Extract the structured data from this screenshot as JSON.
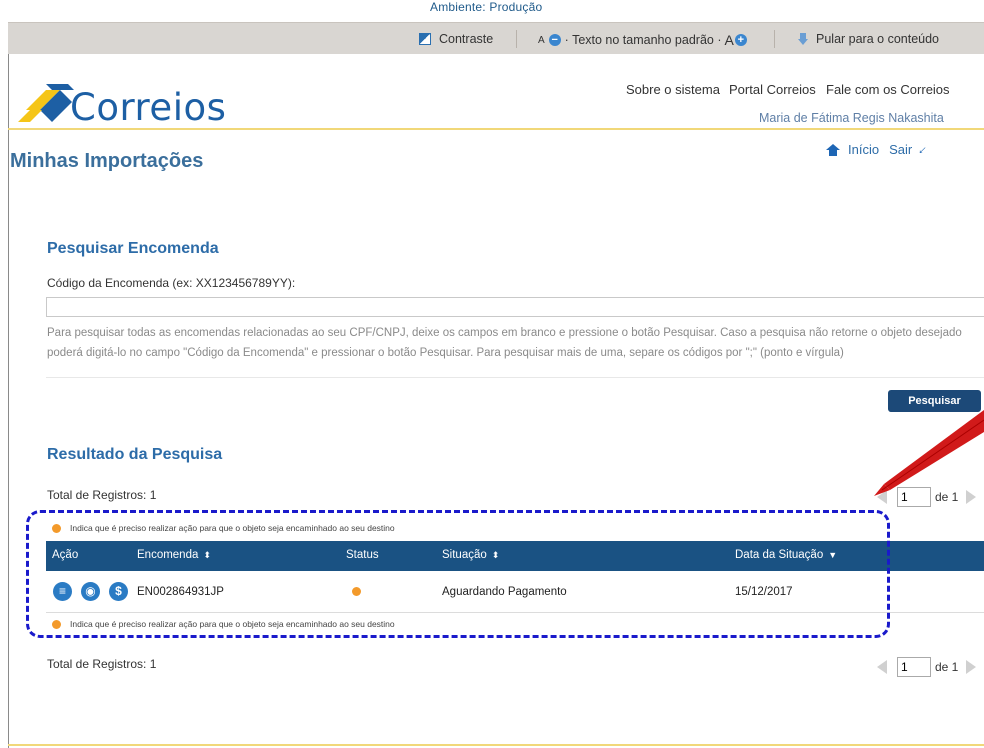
{
  "environment": {
    "label": "Ambiente: Produção"
  },
  "accessibility_bar": {
    "contrast_label": "Contraste",
    "font_decrease_prefix": "A",
    "font_default_label": "· Texto no tamanho padrão ·",
    "font_increase_prefix": "A",
    "skip_label": "Pular para o conteúdo"
  },
  "header": {
    "logo_text": "Correios",
    "links": [
      "Sobre o sistema",
      "Portal Correios",
      "Fale com os Correios"
    ],
    "user_name": "Maria de Fátima Regis Nakashita",
    "page_title": "Minhas Importações",
    "home_label": "Início",
    "exit_label": "Sair"
  },
  "search": {
    "title": "Pesquisar Encomenda",
    "field_label": "Código da Encomenda (ex: XX123456789YY):",
    "field_value": "",
    "help_line_1": "Para pesquisar todas as encomendas relacionadas ao seu CPF/CNPJ, deixe os campos em branco e pressione o botão Pesquisar. Caso a pesquisa não retorne o objeto desejado",
    "help_line_2": "poderá digitá-lo no campo \"Código da Encomenda\" e pressionar o botão Pesquisar. Para pesquisar mais de uma, separe os códigos por \";\" (ponto e vírgula)",
    "button_label": "Pesquisar"
  },
  "results": {
    "title": "Resultado da Pesquisa",
    "total_label": "Total de Registros: 1",
    "pager": {
      "current_page": "1",
      "of_label": "de 1"
    },
    "legend": "Indica que é preciso realizar ação para que o objeto seja encaminhado ao seu destino",
    "columns": {
      "action": "Ação",
      "tracking": "Encomenda",
      "status": "Status",
      "situation": "Situação",
      "date": "Data da Situação"
    },
    "rows": [
      {
        "tracking": "EN002864931JP",
        "status_color": "#f39a2b",
        "situation": "Aguardando Pagamento",
        "date": "15/12/2017"
      }
    ]
  },
  "colors": {
    "brand_blue": "#1d5fa4",
    "table_header": "#1a5283",
    "button": "#1c4978",
    "accent_yellow": "#f1d879",
    "highlight_dash": "#1a1acb",
    "annotation_arrow": "#d11a1a"
  },
  "icons": {
    "action_buttons": [
      "list-icon",
      "eye-icon",
      "dollar-icon"
    ]
  }
}
